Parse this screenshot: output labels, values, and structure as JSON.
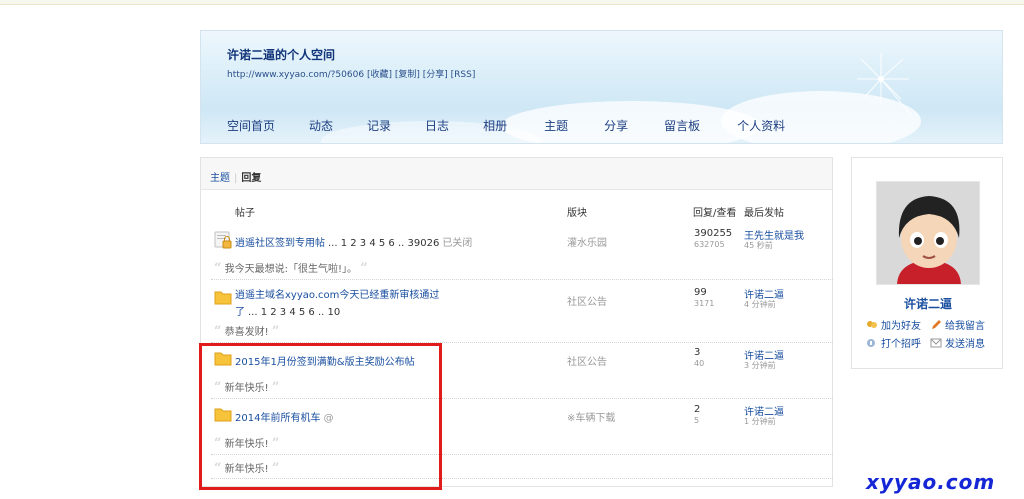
{
  "header": {
    "title": "许诺二逼的个人空间",
    "url": "http://www.xyyao.com/?50606",
    "links": [
      "[收藏]",
      "[复制]",
      "[分享]",
      "[RSS]"
    ],
    "nav": [
      "空间首页",
      "动态",
      "记录",
      "日志",
      "相册",
      "主题",
      "分享",
      "留言板",
      "个人资料"
    ]
  },
  "tabs": {
    "topics": "主题",
    "replies": "回复"
  },
  "columns": {
    "post": "帖子",
    "forum": "版块",
    "stats": "回复/查看",
    "last": "最后发帖"
  },
  "rows": [
    {
      "title": "逍遥社区签到专用帖",
      "pages": "... 1 2 3 4 5 6 .. 39026",
      "closed": "已关闭",
      "quote": "我今天最想说:「很生气啦!」。",
      "forum": "灌水乐园",
      "replies": "390255",
      "views": "632705",
      "last_user": "王先生就是我",
      "last_time": "45 秒前"
    },
    {
      "title": "逍遥主域名xyyao.com今天已经重新审核通过",
      "title_line2": "了",
      "pages": "... 1 2 3 4 5 6 .. 10",
      "quote": "恭喜发财!",
      "forum": "社区公告",
      "replies": "99",
      "views": "3171",
      "last_user": "许诺二逼",
      "last_time": "4 分钟前"
    },
    {
      "title": "2015年1月份签到满勤&版主奖励公布帖",
      "quote": "新年快乐!",
      "forum": "社区公告",
      "replies": "3",
      "views": "40",
      "last_user": "许诺二逼",
      "last_time": "3 分钟前"
    },
    {
      "title": "2014年前所有机车",
      "mark": "@",
      "quote": "新年快乐!",
      "quote2": "新年快乐!",
      "forum": "※车辆下载",
      "replies": "2",
      "views": "5",
      "last_user": "许诺二逼",
      "last_time": "1 分钟前"
    }
  ],
  "sidebar": {
    "username": "许诺二逼",
    "actions": [
      "加为好友",
      "给我留言",
      "打个招呼",
      "发送消息"
    ]
  },
  "watermark": "xyyao.com",
  "colors": {
    "link": "#1a4fa0",
    "highlight": "#e11b1b",
    "watermark": "#1526d6"
  }
}
